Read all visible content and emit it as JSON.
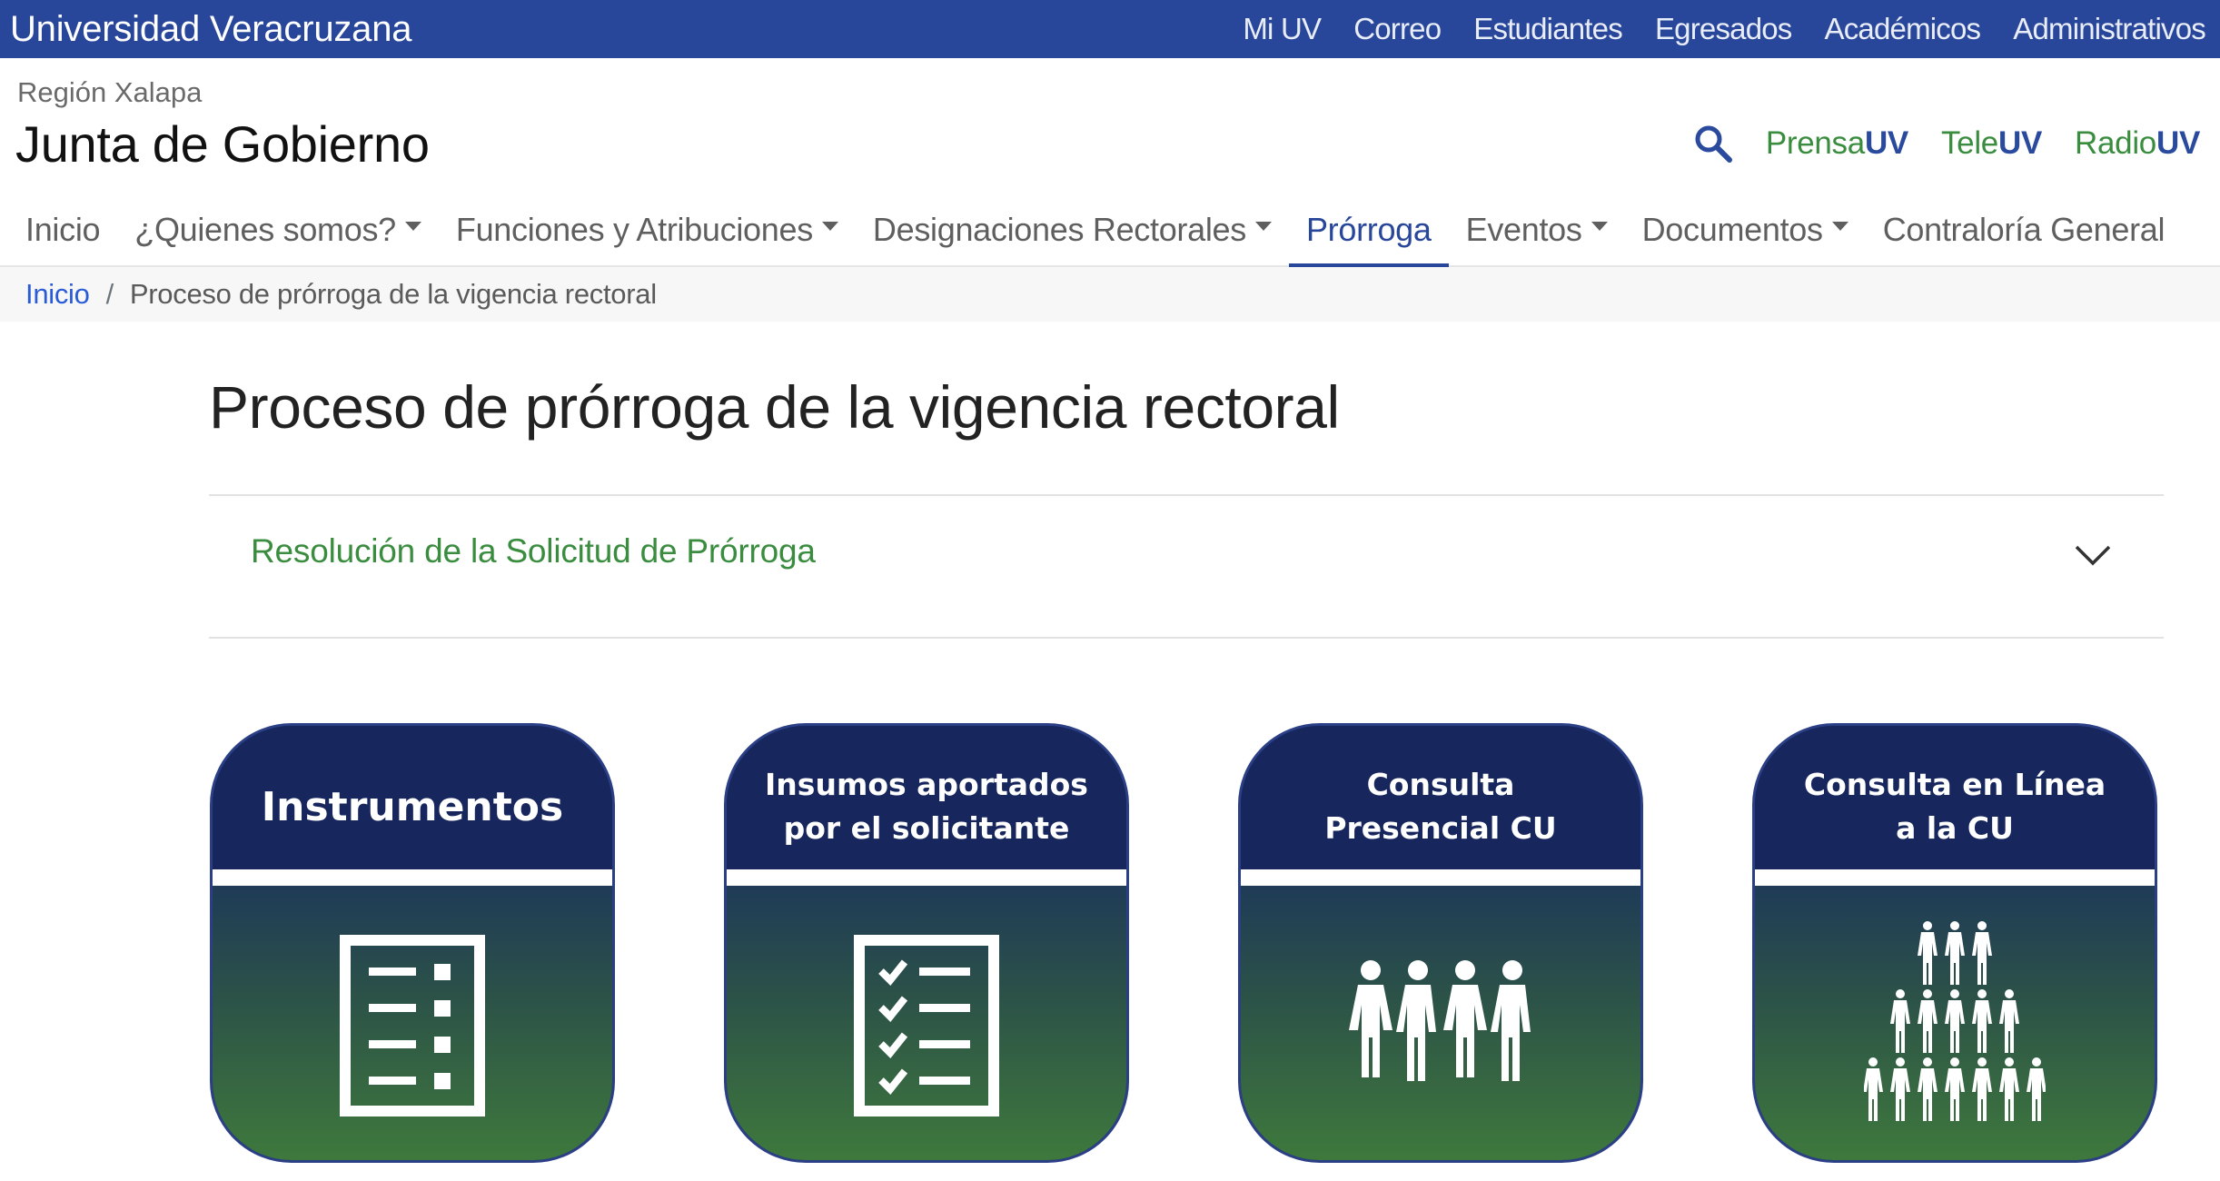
{
  "topbar": {
    "brand": "Universidad Veracruzana",
    "links": [
      "Mi UV",
      "Correo",
      "Estudiantes",
      "Egresados",
      "Académicos",
      "Administrativos"
    ]
  },
  "header": {
    "region": "Región Xalapa",
    "title": "Junta de Gobierno",
    "media": [
      {
        "a": "Prensa",
        "b": "UV"
      },
      {
        "a": "Tele",
        "b": "UV"
      },
      {
        "a": "Radio",
        "b": "UV"
      }
    ]
  },
  "nav": {
    "items": [
      {
        "label": "Inicio",
        "dropdown": false,
        "active": false
      },
      {
        "label": "¿Quienes somos?",
        "dropdown": true,
        "active": false
      },
      {
        "label": "Funciones y Atribuciones",
        "dropdown": true,
        "active": false
      },
      {
        "label": "Designaciones Rectorales",
        "dropdown": true,
        "active": false
      },
      {
        "label": "Prórroga",
        "dropdown": false,
        "active": true
      },
      {
        "label": "Eventos",
        "dropdown": true,
        "active": false
      },
      {
        "label": "Documentos",
        "dropdown": true,
        "active": false
      },
      {
        "label": "Contraloría General",
        "dropdown": false,
        "active": false
      }
    ]
  },
  "breadcrumb": {
    "home": "Inicio",
    "separator": "/",
    "current": "Proceso de prórroga de la vigencia rectoral"
  },
  "main": {
    "title": "Proceso de prórroga de la vigencia rectoral",
    "accordion_title": "Resolución de la Solicitud de Prórroga",
    "cards": [
      {
        "title": "Instrumentos",
        "icon": "list-document-icon"
      },
      {
        "title": "Insumos aportados por el solicitante",
        "icon": "checklist-icon"
      },
      {
        "title": "Consulta Presencial CU",
        "icon": "people-group-icon"
      },
      {
        "title": "Consulta en Línea a la CU",
        "icon": "crowd-pyramid-icon"
      }
    ]
  },
  "colors": {
    "topbar": "#28479a",
    "accent_green": "#3a8c3f",
    "card_navy": "#17275e"
  }
}
